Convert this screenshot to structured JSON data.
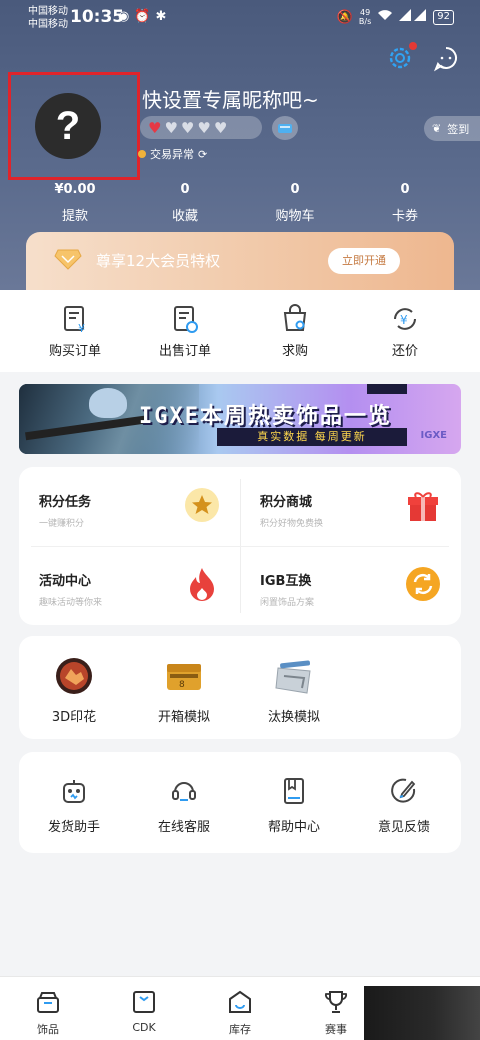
{
  "status": {
    "carrier1": "中国移动",
    "carrier2": "中国移动",
    "time": "10:35",
    "net_speed_value": "49",
    "net_speed_unit": "B/s",
    "battery": "92"
  },
  "profile": {
    "avatar_glyph": "?",
    "nickname": "快设置专属昵称吧~",
    "hearts_filled": 1,
    "hearts_total": 5,
    "trade_status": "交易异常",
    "signin_label": "签到"
  },
  "stats": [
    {
      "value": "¥0.00",
      "label": "提款"
    },
    {
      "value": "0",
      "label": "收藏"
    },
    {
      "value": "0",
      "label": "购物车"
    },
    {
      "value": "0",
      "label": "卡券"
    }
  ],
  "vip": {
    "text": "尊享12大会员特权",
    "button": "立即开通"
  },
  "orders": [
    {
      "label": "购买订单",
      "icon": "purchase-order-icon"
    },
    {
      "label": "出售订单",
      "icon": "sell-order-icon"
    },
    {
      "label": "求购",
      "icon": "buy-request-icon"
    },
    {
      "label": "还价",
      "icon": "counter-offer-icon"
    }
  ],
  "promo": {
    "title": "IGXE本周热卖饰品一览",
    "tagline": "真实数据 每周更新",
    "logo": "IGXE"
  },
  "features": [
    {
      "title": "积分任务",
      "subtitle": "一键赚积分",
      "icon": "star-icon",
      "color": "#f2c230"
    },
    {
      "title": "积分商城",
      "subtitle": "积分好物免费换",
      "icon": "gift-icon",
      "color": "#e53935"
    },
    {
      "title": "活动中心",
      "subtitle": "趣味活动等你来",
      "icon": "fire-icon",
      "color": "#e8413c"
    },
    {
      "title": "IGB互换",
      "subtitle": "闲置饰品方案",
      "icon": "exchange-icon",
      "color": "#f5a623"
    }
  ],
  "tools": [
    {
      "label": "3D印花",
      "icon": "sticker-3d-icon"
    },
    {
      "label": "开箱模拟",
      "icon": "case-open-icon"
    },
    {
      "label": "汰换模拟",
      "icon": "trade-up-icon"
    }
  ],
  "services": [
    {
      "label": "发货助手",
      "icon": "robot-icon"
    },
    {
      "label": "在线客服",
      "icon": "headset-icon"
    },
    {
      "label": "帮助中心",
      "icon": "book-icon"
    },
    {
      "label": "意见反馈",
      "icon": "feedback-pen-icon"
    }
  ],
  "tabs": [
    {
      "label": "饰品",
      "icon": "market-icon"
    },
    {
      "label": "CDK",
      "icon": "cdk-icon"
    },
    {
      "label": "库存",
      "icon": "inventory-icon"
    },
    {
      "label": "赛事",
      "icon": "trophy-icon"
    }
  ]
}
